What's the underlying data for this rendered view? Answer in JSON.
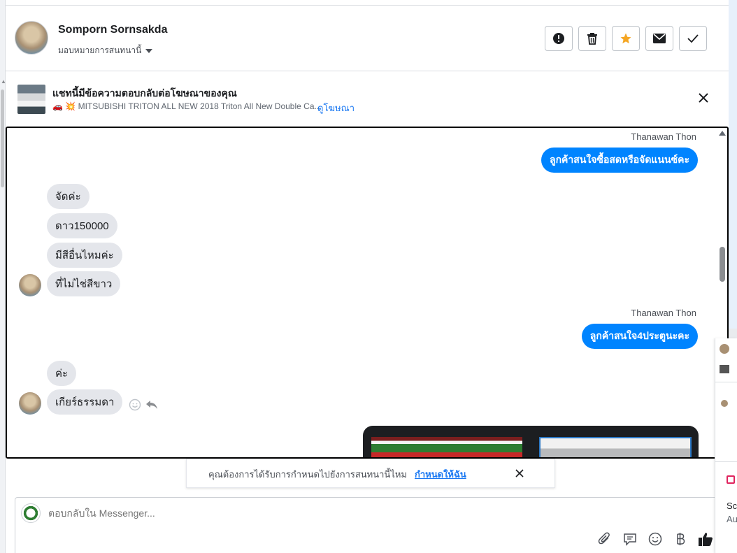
{
  "header": {
    "contact_name": "Somporn Sornsakda",
    "assign_label": "มอบหมายการสนทนานี้",
    "actions": [
      "spam-icon",
      "trash-icon",
      "star-icon",
      "envelope-icon",
      "check-icon"
    ],
    "star_color": "#f5a623"
  },
  "ad": {
    "title": "แชทนี้มีข้อความตอบกลับต่อโฆษณาของคุณ",
    "subtitle": "MITSUBISHI TRITON ALL NEW 2018 Triton All New Double Ca...",
    "view_ad_link": "ดูโฆษณา"
  },
  "messages": [
    {
      "sender": "Thanawan Thon",
      "text": "ลูกค้าสนใจซื้อสดหรือจัดแนนซ์คะ",
      "direction": "out"
    },
    {
      "text": "จัดค่ะ",
      "direction": "in"
    },
    {
      "text": "ดาว150000",
      "direction": "in"
    },
    {
      "text": "มีสีอื่นไหมค่ะ",
      "direction": "in"
    },
    {
      "text": "ที่ไม่ไช่สีขาว",
      "direction": "in"
    },
    {
      "sender": "Thanawan Thon",
      "text": "ลูกค้าสนใจ4ประตูนะคะ",
      "direction": "out"
    },
    {
      "text": "ค่ะ",
      "direction": "in"
    },
    {
      "text": "เกียร์ธรรมดา",
      "direction": "in"
    }
  ],
  "followup": {
    "text": "คุณต้องการได้รับการกำหนดไปยังการสนทนานี้ไหม",
    "link": "กำหนดให้ฉัน"
  },
  "composer": {
    "placeholder": "ตอบกลับใน Messenger...",
    "tools": [
      "attach-icon",
      "quick-reply-icon",
      "emoji-icon",
      "baht-icon",
      "like-icon"
    ]
  },
  "side_panel": {
    "line1": "Scr",
    "line2": "Au"
  },
  "colors": {
    "accent": "#0084ff",
    "link": "#1877f2",
    "incoming_bubble": "#e4e6eb"
  }
}
